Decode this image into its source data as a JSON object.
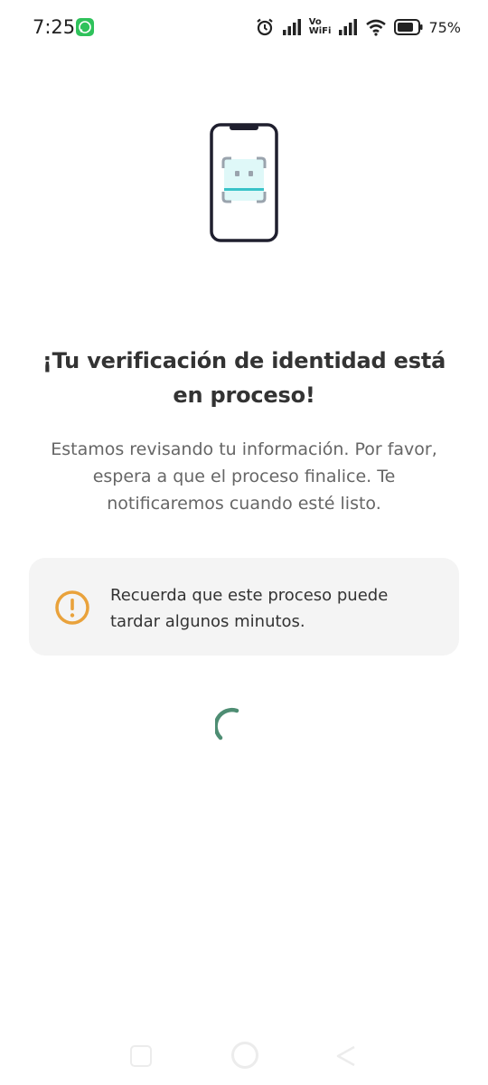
{
  "status_bar": {
    "time": "7:25",
    "vowifi_line1": "Vo",
    "vowifi_line2": "WiFi",
    "battery_percent": "75%",
    "notification_icon": "whatsapp-icon"
  },
  "illustration": {
    "icon": "phone-face-scan-icon"
  },
  "content": {
    "title": "¡Tu verificación de identidad está en proceso!",
    "description": "Estamos revisando tu información. Por favor, espera a que el proceso finalice. Te notificaremos cuando esté listo.",
    "notice": {
      "icon": "info-icon",
      "text": "Recuerda que este proceso puede tardar algunos minutos.",
      "accent_color": "#e9a23b"
    }
  },
  "spinner": {
    "color": "#4e8d73"
  },
  "nav_bar": {
    "recents": "recents-icon",
    "home": "home-icon",
    "back": "back-icon"
  }
}
